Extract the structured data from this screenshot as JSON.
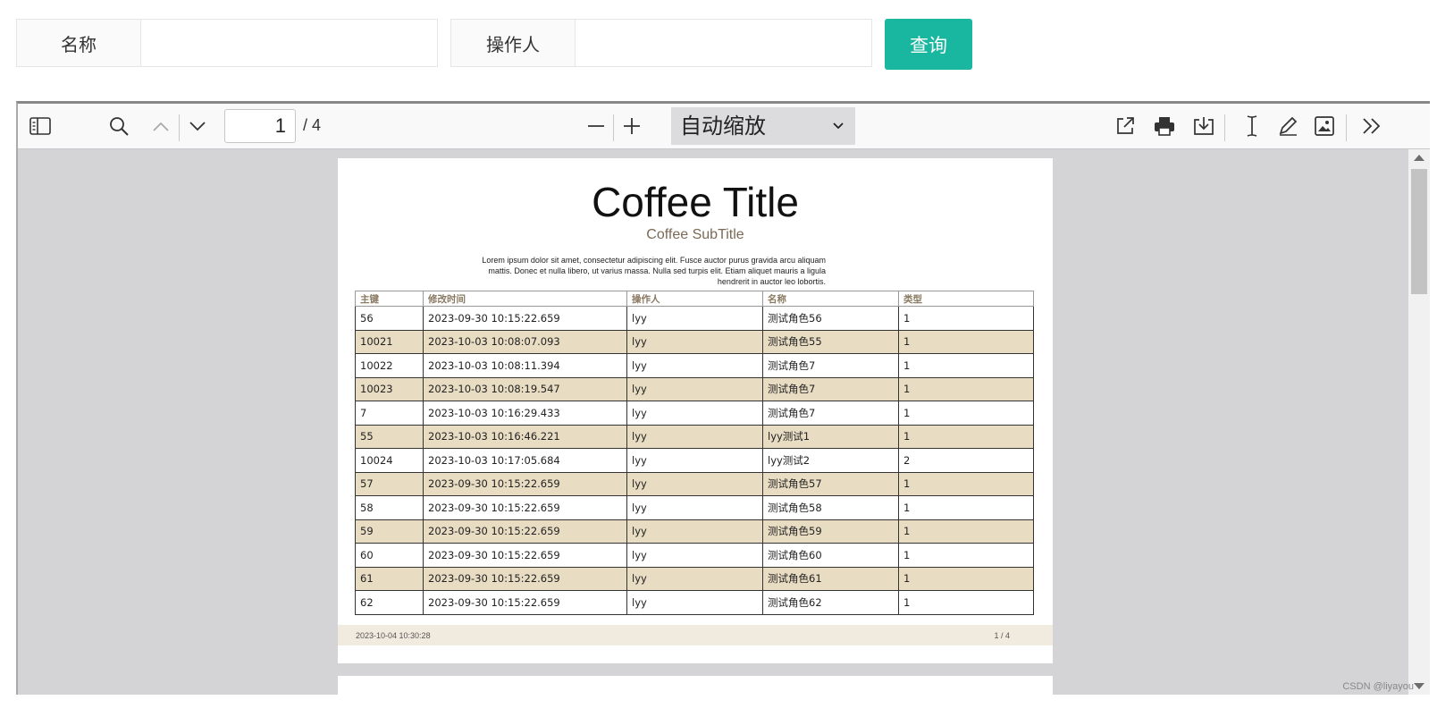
{
  "search": {
    "name_label": "名称",
    "name_value": "",
    "operator_label": "操作人",
    "operator_value": "",
    "query_button": "查询"
  },
  "viewer": {
    "page_number": "1",
    "page_count": "/ 4",
    "zoom_value": "自动缩放",
    "icons": [
      "sidebar-toggle-icon",
      "search-icon",
      "chevron-up-icon",
      "chevron-down-icon",
      "zoom-out-icon",
      "zoom-in-icon",
      "open-external-icon",
      "print-icon",
      "download-icon",
      "text-cursor-icon",
      "draw-pen-icon",
      "insert-image-icon",
      "more-tools-icon"
    ]
  },
  "document": {
    "title": "Coffee Title",
    "subtitle": "Coffee SubTitle",
    "lorem": "Lorem ipsum dolor sit amet, consectetur adipiscing elit. Fusce auctor purus gravida arcu aliquam mattis. Donec et nulla libero, ut varius massa. Nulla sed turpis elit. Etiam aliquet mauris a ligula hendrerit in auctor leo lobortis.",
    "columns": [
      "主键",
      "修改时间",
      "操作人",
      "名称",
      "类型"
    ],
    "rows": [
      [
        "56",
        "2023-09-30 10:15:22.659",
        "lyy",
        "测试角色56",
        "1"
      ],
      [
        "10021",
        "2023-10-03 10:08:07.093",
        "lyy",
        "测试角色55",
        "1"
      ],
      [
        "10022",
        "2023-10-03 10:08:11.394",
        "lyy",
        "测试角色7",
        "1"
      ],
      [
        "10023",
        "2023-10-03 10:08:19.547",
        "lyy",
        "测试角色7",
        "1"
      ],
      [
        "7",
        "2023-10-03 10:16:29.433",
        "lyy",
        "测试角色7",
        "1"
      ],
      [
        "55",
        "2023-10-03 10:16:46.221",
        "lyy",
        "lyy测试1",
        "1"
      ],
      [
        "10024",
        "2023-10-03 10:17:05.684",
        "lyy",
        "lyy测试2",
        "2"
      ],
      [
        "57",
        "2023-09-30 10:15:22.659",
        "lyy",
        "测试角色57",
        "1"
      ],
      [
        "58",
        "2023-09-30 10:15:22.659",
        "lyy",
        "测试角色58",
        "1"
      ],
      [
        "59",
        "2023-09-30 10:15:22.659",
        "lyy",
        "测试角色59",
        "1"
      ],
      [
        "60",
        "2023-09-30 10:15:22.659",
        "lyy",
        "测试角色60",
        "1"
      ],
      [
        "61",
        "2023-09-30 10:15:22.659",
        "lyy",
        "测试角色61",
        "1"
      ],
      [
        "62",
        "2023-09-30 10:15:22.659",
        "lyy",
        "测试角色62",
        "1"
      ]
    ],
    "footer_left": "2023-10-04 10:30:28",
    "footer_right": "1 / 4"
  },
  "watermark": "CSDN @liyayou",
  "colors": {
    "accent": "#1ab7a0",
    "row_alt": "#e8dcc3",
    "footer_bg": "#f1eadf",
    "viewer_bg": "#d4d4d7"
  }
}
